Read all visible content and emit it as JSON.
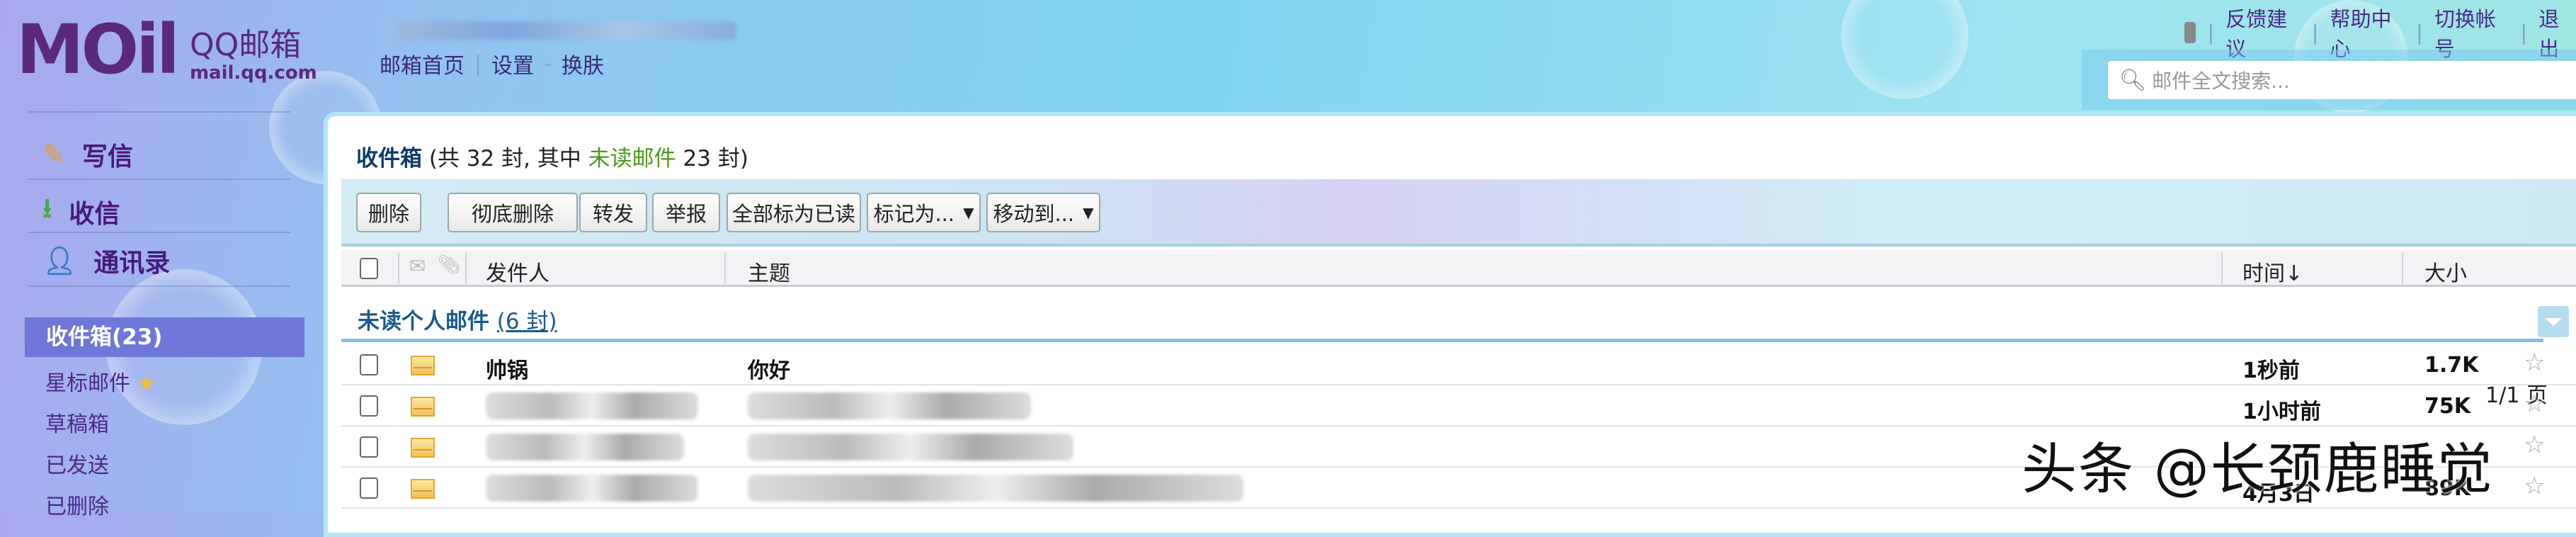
{
  "logo": {
    "word": "MOil",
    "cn": "QQ邮箱",
    "en": "mail.qq.com"
  },
  "nav": {
    "home": "邮箱首页",
    "settings": "设置",
    "skin": "换肤",
    "sep1": "|",
    "sep2": "-"
  },
  "top_links": [
    "反馈建议",
    "帮助中心",
    "切换帐号",
    "退出"
  ],
  "search": {
    "placeholder": "邮件全文搜索..."
  },
  "sidebar": {
    "compose": "写信",
    "receive": "收信",
    "contacts": "通讯录",
    "folders": [
      "收件箱(23)",
      "星标邮件",
      "草稿箱",
      "已发送",
      "已删除"
    ]
  },
  "inbox": {
    "name": "收件箱",
    "summary_pre": "(共 32 封, 其中 ",
    "unread_link": "未读邮件",
    "summary_post": " 23 封)"
  },
  "toolbar": {
    "delete": "删除",
    "delete_perm": "彻底删除",
    "forward": "转发",
    "report": "举报",
    "mark_all_read": "全部标为已读",
    "mark_as": "标记为...",
    "move_to": "移动到...",
    "pager": "1/1 页"
  },
  "columns": {
    "sender": "发件人",
    "subject": "主题",
    "time": "时间↓",
    "size": "大小"
  },
  "group": {
    "title": "未读个人邮件",
    "count": "(6 封)"
  },
  "rows": [
    {
      "sender": "帅锅",
      "subject": "你好",
      "time": "1秒前",
      "size": "1.7K"
    },
    {
      "sender": "",
      "subject": "",
      "time": "1小时前",
      "size": "75K"
    },
    {
      "sender": "",
      "subject": "",
      "time": "",
      "size": ""
    },
    {
      "sender": "",
      "subject": "",
      "time": "4月3日",
      "size": "89K"
    }
  ],
  "watermark": "头条 @长颈鹿睡觉"
}
